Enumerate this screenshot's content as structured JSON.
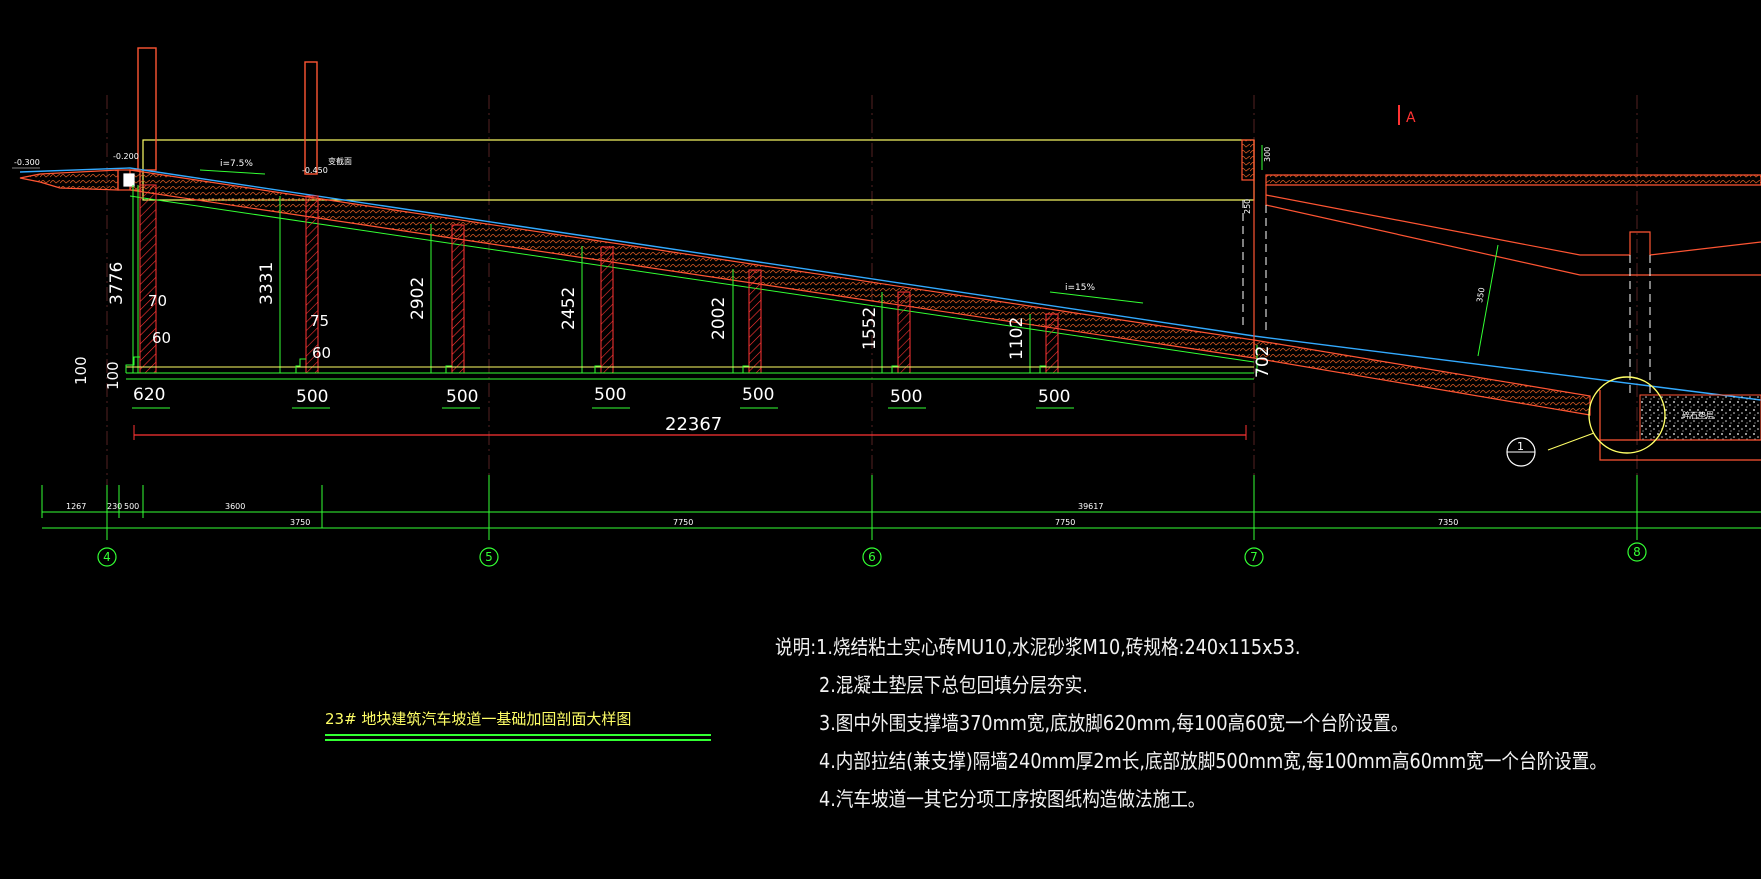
{
  "drawing": {
    "title": "23# 地块建筑汽车坡道一基础加固剖面大样图",
    "section_marker": "A",
    "colors": {
      "background": "#000000",
      "grid": "#33ff33",
      "dimension": "#33ff33",
      "slab": "#ff5533",
      "surface": "#33aaff",
      "outline": "#ffff66",
      "hatch": "#ff3333",
      "text": "#ffffff"
    }
  },
  "elevations": {
    "left_ground": "-0.300",
    "ramp_top": "-0.200",
    "post_b": "-0.450",
    "post_b_note": "变截面"
  },
  "slopes": {
    "upper": "i=7.5%",
    "lower": "i=15%"
  },
  "ramp_heights": [
    "3776",
    "3331",
    "2902",
    "2452",
    "2002",
    "1552",
    "1102",
    "702"
  ],
  "footings": [
    "620",
    "500",
    "500",
    "500",
    "500",
    "500",
    "500"
  ],
  "step_dims": {
    "step_h": "70",
    "step_w": "60",
    "step_h2": "75",
    "step_w2": "60",
    "base_a": "100",
    "base_b": "100"
  },
  "overall_length": "22367",
  "right_labels": {
    "top_dim": "300",
    "wall_dim": "250",
    "inclined_dim": "350",
    "gravel": "碎石垫层"
  },
  "grid_lines": [
    "4",
    "5",
    "6",
    "7",
    "8"
  ],
  "bottom_dims": {
    "row1": [
      "1267",
      "230",
      "500",
      "3600"
    ],
    "row1_right": "39617",
    "row2": [
      "3750",
      "7750",
      "7750",
      "7350"
    ]
  },
  "detail_callout": "1",
  "notes": [
    "说明:1.烧结粘土实心砖MU10,水泥砂浆M10,砖规格:240x115x53.",
    "2.混凝土垫层下总包回填分层夯实.",
    "3.图中外围支撑墙370mm宽,底放脚620mm,每100高60宽一个台阶设置。",
    "4.内部拉结(兼支撑)隔墙240mm厚2m长,底部放脚500mm宽,每100mm高60mm宽一个台阶设置。",
    "4.汽车坡道一其它分项工序按图纸构造做法施工。"
  ]
}
